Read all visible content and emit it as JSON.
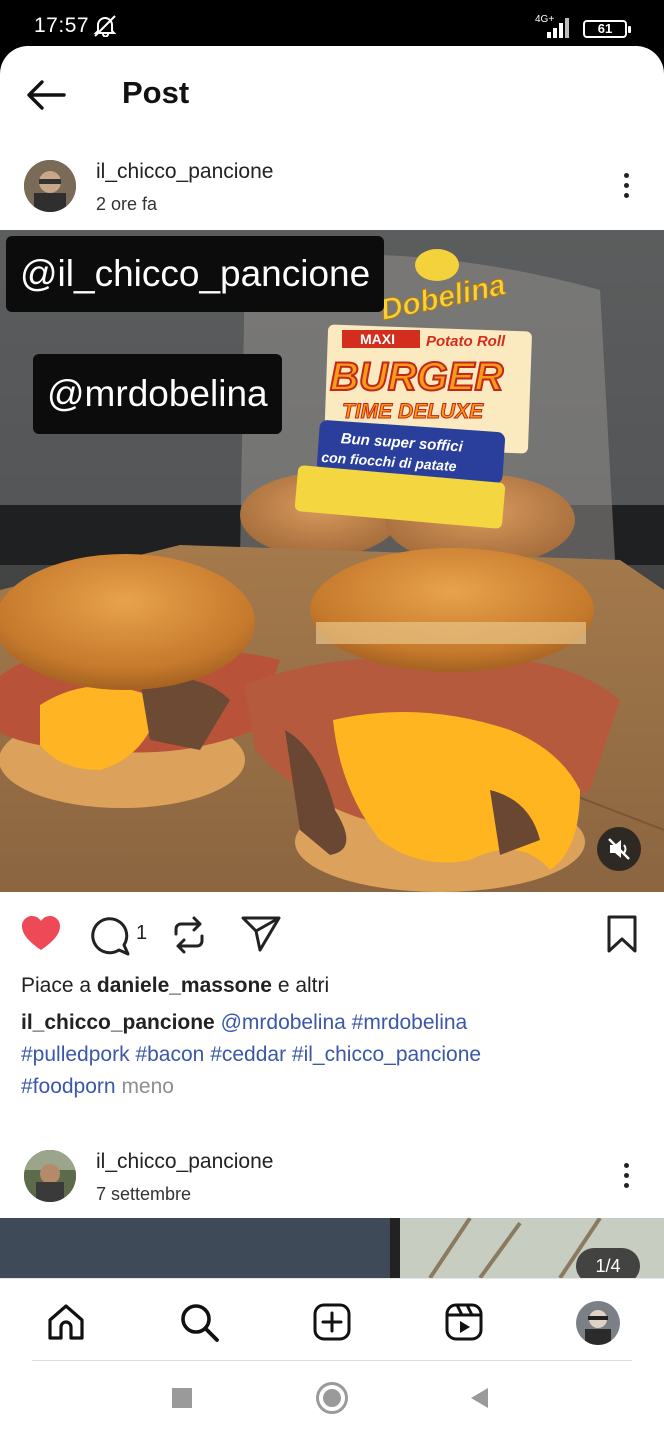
{
  "status_bar": {
    "time": "17:57",
    "network": "4G+",
    "battery": "61"
  },
  "header": {
    "title": "Post"
  },
  "post": {
    "username": "il_chicco_pancione",
    "time": "2 ore fa",
    "tags": [
      "@il_chicco_pancione",
      "@mrdobelina"
    ],
    "comment_count": "1",
    "likes": {
      "prefix": "Piace a",
      "user": "daniele_massone",
      "suffix": "e altri"
    },
    "caption": {
      "author": "il_chicco_pancione",
      "mention": "@mrdobelina",
      "hashtags": [
        "#mrdobelina",
        "#pulledpork",
        "#bacon",
        "#ceddar",
        "#il_chicco_pancione",
        "#foodporn"
      ],
      "more": "meno"
    }
  },
  "post2": {
    "username": "il_chicco_pancione",
    "time": "7 settembre",
    "counter": "1/4"
  },
  "package_text": {
    "brand": "Dobelina",
    "line1": "MAXI",
    "line2": "Potato Roll",
    "line3": "BURGER",
    "line4": "TIME DELUXE",
    "line5": "Bun super soffici",
    "line6": "con fiocchi di patate"
  },
  "colors": {
    "like": "#ed4956",
    "link": "#3b57a8",
    "muted": "#8e8e8e"
  },
  "icons": {
    "back": "arrow-left-icon",
    "more": "vertical-dots-icon",
    "like": "heart-filled-icon",
    "comment": "comment-icon",
    "repost": "repost-icon",
    "share": "paper-plane-icon",
    "save": "bookmark-icon",
    "mute": "speaker-muted-icon",
    "nav": [
      "home-icon",
      "search-icon",
      "create-icon",
      "reels-icon",
      "profile-avatar"
    ]
  }
}
